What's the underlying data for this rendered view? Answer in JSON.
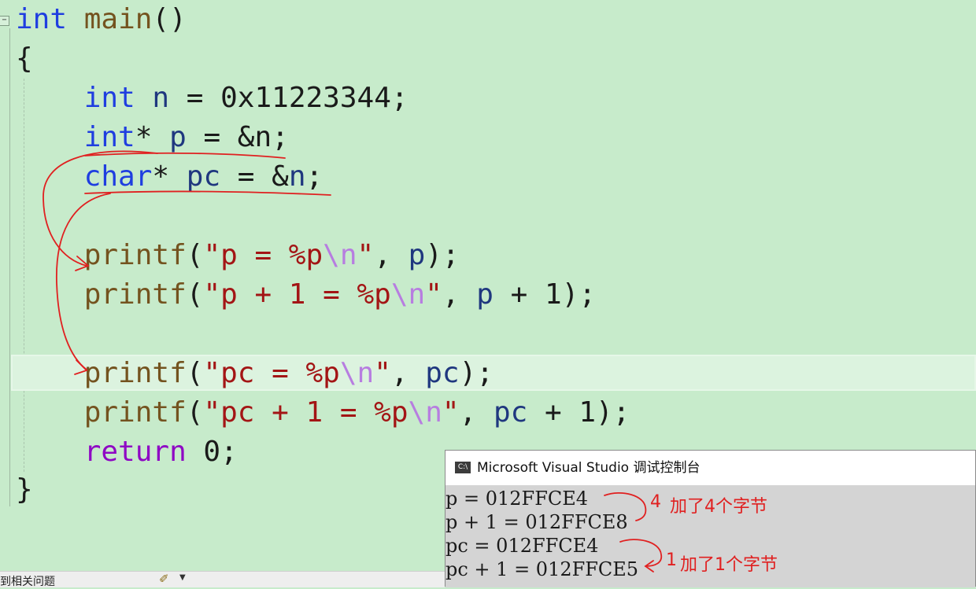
{
  "editor": {
    "lines": [
      {
        "tokens": [
          {
            "t": "int",
            "c": "kw"
          },
          {
            "t": " "
          },
          {
            "t": "main",
            "c": "fn"
          },
          {
            "t": "()"
          }
        ]
      },
      {
        "tokens": [
          {
            "t": "{"
          }
        ]
      },
      {
        "tokens": [
          {
            "t": "    "
          },
          {
            "t": "int",
            "c": "kw"
          },
          {
            "t": " "
          },
          {
            "t": "n",
            "c": "id"
          },
          {
            "t": " = 0x11223344;"
          }
        ]
      },
      {
        "tokens": [
          {
            "t": "    "
          },
          {
            "t": "int",
            "c": "kw"
          },
          {
            "t": "* "
          },
          {
            "t": "p",
            "c": "id"
          },
          {
            "t": " = &n;"
          }
        ]
      },
      {
        "tokens": [
          {
            "t": "    "
          },
          {
            "t": "char",
            "c": "kw"
          },
          {
            "t": "* "
          },
          {
            "t": "pc",
            "c": "id"
          },
          {
            "t": " = &"
          },
          {
            "t": "n",
            "c": "id"
          },
          {
            "t": ";"
          }
        ]
      },
      {
        "tokens": [
          {
            "t": ""
          }
        ]
      },
      {
        "tokens": [
          {
            "t": "    "
          },
          {
            "t": "printf",
            "c": "fn"
          },
          {
            "t": "("
          },
          {
            "t": "\"p = %p",
            "c": "str"
          },
          {
            "t": "\\n",
            "c": "esc"
          },
          {
            "t": "\"",
            "c": "str"
          },
          {
            "t": ", "
          },
          {
            "t": "p",
            "c": "id"
          },
          {
            "t": ");"
          }
        ]
      },
      {
        "tokens": [
          {
            "t": "    "
          },
          {
            "t": "printf",
            "c": "fn"
          },
          {
            "t": "("
          },
          {
            "t": "\"p + 1 = %p",
            "c": "str"
          },
          {
            "t": "\\n",
            "c": "esc"
          },
          {
            "t": "\"",
            "c": "str"
          },
          {
            "t": ", "
          },
          {
            "t": "p",
            "c": "id"
          },
          {
            "t": " + 1);"
          }
        ]
      },
      {
        "tokens": [
          {
            "t": ""
          }
        ]
      },
      {
        "tokens": [
          {
            "t": "    "
          },
          {
            "t": "printf",
            "c": "fn"
          },
          {
            "t": "("
          },
          {
            "t": "\"pc = %p",
            "c": "str"
          },
          {
            "t": "\\n",
            "c": "esc"
          },
          {
            "t": "\"",
            "c": "str"
          },
          {
            "t": ", "
          },
          {
            "t": "pc",
            "c": "id"
          },
          {
            "t": ");"
          }
        ]
      },
      {
        "tokens": [
          {
            "t": "    "
          },
          {
            "t": "printf",
            "c": "fn"
          },
          {
            "t": "("
          },
          {
            "t": "\"pc + 1 = %p",
            "c": "str"
          },
          {
            "t": "\\n",
            "c": "esc"
          },
          {
            "t": "\"",
            "c": "str"
          },
          {
            "t": ", "
          },
          {
            "t": "pc",
            "c": "id"
          },
          {
            "t": " + 1);"
          }
        ]
      },
      {
        "tokens": [
          {
            "t": "    "
          },
          {
            "t": "return",
            "c": "kw2"
          },
          {
            "t": " 0;"
          }
        ]
      },
      {
        "tokens": [
          {
            "t": "}"
          }
        ]
      }
    ]
  },
  "console": {
    "icon_text": "C:\\",
    "title": "Microsoft Visual Studio 调试控制台",
    "output": [
      "p = 012FFCE4",
      "p + 1 = 012FFCE8",
      "pc = 012FFCE4",
      "pc + 1 = 012FFCE5"
    ]
  },
  "annotations": {
    "note1_number": "4",
    "note1_text": "加了4个字节",
    "note2_number": "1",
    "note2_text": "加了1个字节",
    "color": "#e02020"
  },
  "statusbar": {
    "label": "到相关问题"
  }
}
